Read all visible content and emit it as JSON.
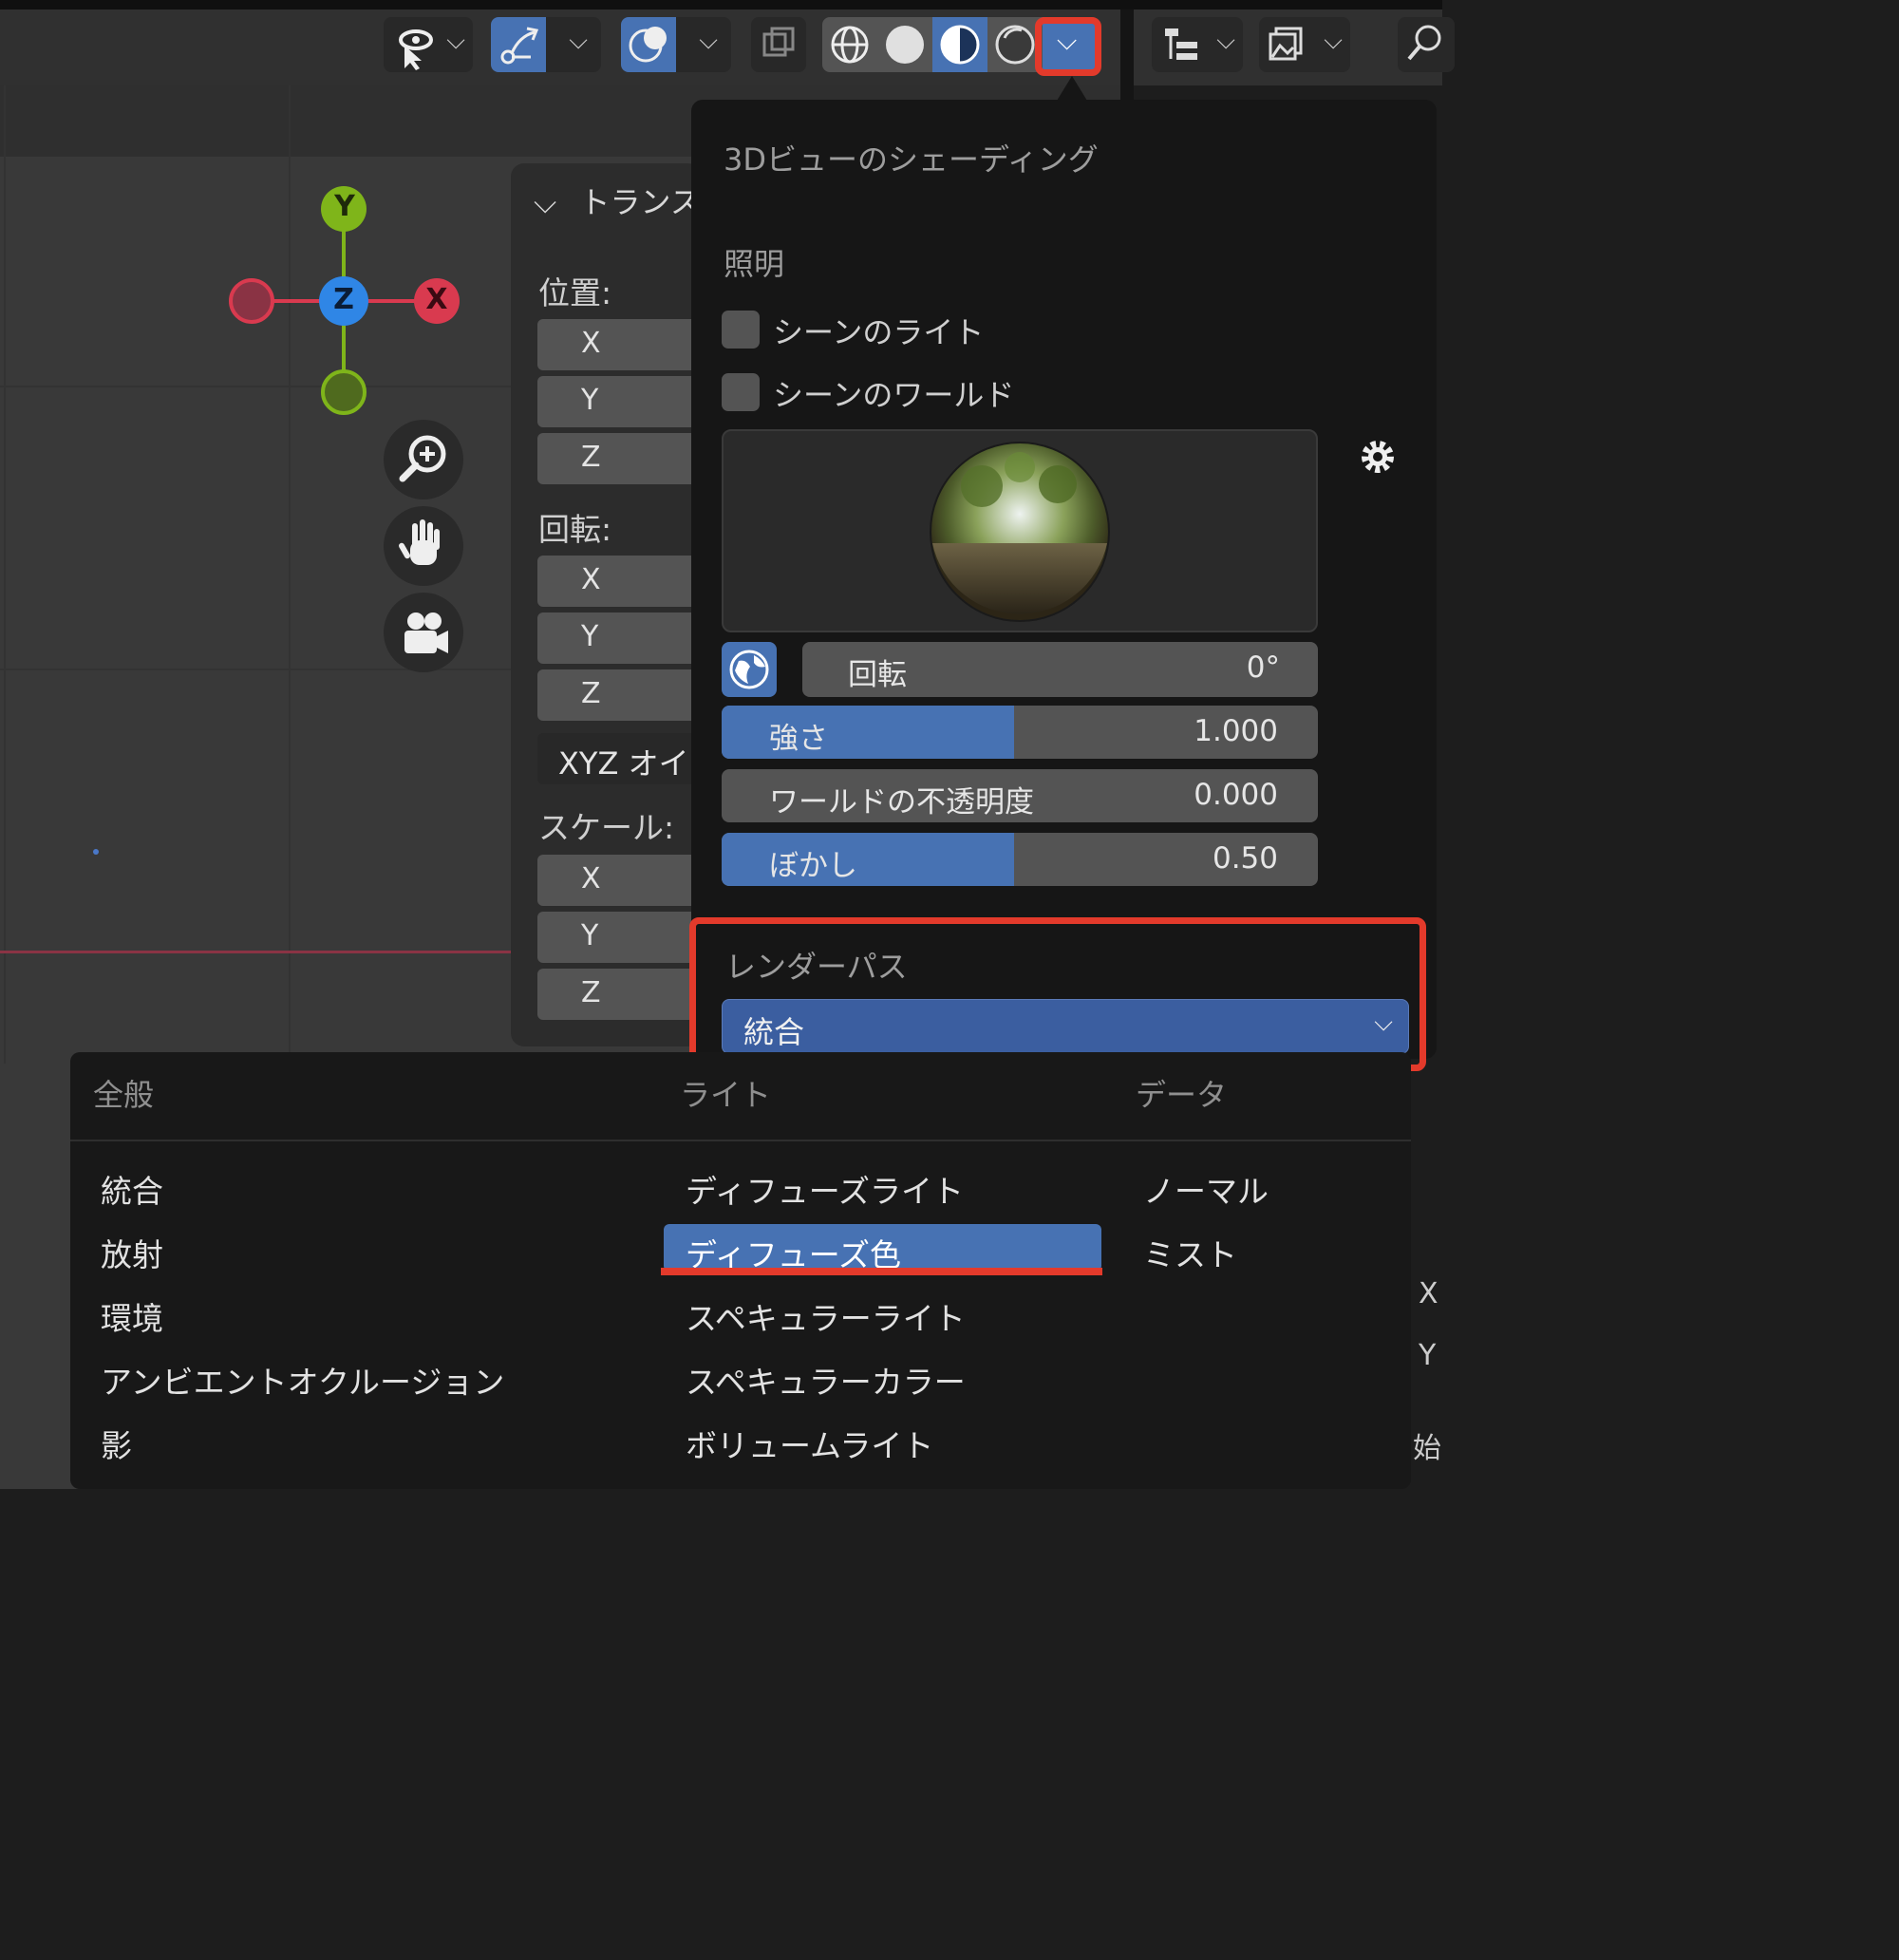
{
  "header": {
    "buttons": [
      "visibility-icon",
      "gizmo-icon",
      "overlay-icon",
      "xray-icon",
      "wireframe-icon",
      "solid-icon",
      "material-preview-icon",
      "rendered-icon",
      "shading-dropdown-icon",
      "outliner-icon",
      "properties-icon",
      "search-icon"
    ]
  },
  "viewport": {
    "gizmo": {
      "y_label": "Y",
      "z_label": "Z",
      "x_label": "X"
    },
    "right_edge": {
      "x": "X",
      "y": "Y",
      "start": "始"
    }
  },
  "npanel": {
    "title": "トランス",
    "location_label": "位置:",
    "rotation_label": "回転:",
    "scale_label": "スケール:",
    "axis_x": "X",
    "axis_y": "Y",
    "axis_z": "Z",
    "rotation_mode": "XYZ オイ"
  },
  "popover": {
    "title": "3Dビューのシェーディング",
    "lighting_label": "照明",
    "scene_lights": "シーンのライト",
    "scene_world": "シーンのワールド",
    "rotation": {
      "label": "回転",
      "value": "0°"
    },
    "strength": {
      "label": "強さ",
      "value": "1.000",
      "fill": 0.49
    },
    "world_opacity": {
      "label": "ワールドの不透明度",
      "value": "0.000",
      "fill": 0.0
    },
    "blur": {
      "label": "ぼかし",
      "value": "0.50",
      "fill": 0.49
    },
    "render_pass_label": "レンダーパス",
    "render_pass_value": "統合"
  },
  "menu": {
    "columns": [
      {
        "header": "全般",
        "items": [
          "統合",
          "放射",
          "環境",
          "アンビエントオクルージョン",
          "影"
        ]
      },
      {
        "header": "ライト",
        "items": [
          "ディフューズライト",
          "ディフューズ色",
          "スペキュラーライト",
          "スペキュラーカラー",
          "ボリュームライト"
        ]
      },
      {
        "header": "データ",
        "items": [
          "ノーマル",
          "ミスト"
        ]
      }
    ],
    "highlighted": "ディフューズ色"
  },
  "colors": {
    "accent": "#4772b3",
    "highlight_red": "#e33a2b",
    "axis_x": "#d93a4f",
    "axis_y": "#7fb51a",
    "axis_z": "#2f86e6"
  }
}
